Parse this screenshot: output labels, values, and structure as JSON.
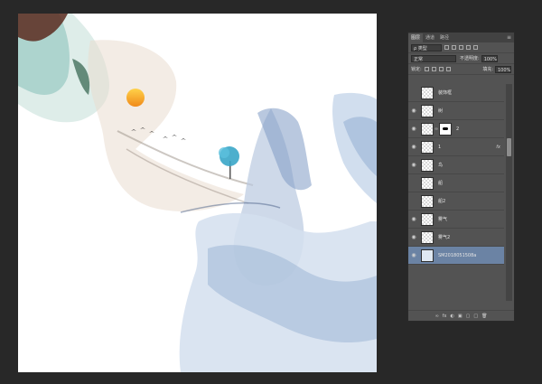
{
  "panel": {
    "tabs": [
      "图层",
      "通道",
      "路径"
    ],
    "menu_glyph": "≡",
    "filter_label": "ρ 类型",
    "blend_mode": "正常",
    "opacity_label": "不透明度:",
    "opacity_value": "100%",
    "lock_label": "锁定:",
    "fill_label": "填充:",
    "fill_value": "100%"
  },
  "layers": [
    {
      "name": "装饰框",
      "visible": false,
      "selected": false
    },
    {
      "name": "树",
      "visible": true,
      "selected": false
    },
    {
      "name": "2",
      "visible": true,
      "selected": false,
      "has_mask": true
    },
    {
      "name": "1",
      "visible": true,
      "selected": false,
      "fx": "fx"
    },
    {
      "name": "鸟",
      "visible": true,
      "selected": false
    },
    {
      "name": "船",
      "visible": false,
      "selected": false
    },
    {
      "name": "船2",
      "visible": false,
      "selected": false
    },
    {
      "name": "雾气",
      "visible": true,
      "selected": false
    },
    {
      "name": "雾气2",
      "visible": true,
      "selected": false
    },
    {
      "name": "SM2018051508a",
      "visible": true,
      "selected": true
    }
  ],
  "footer_icons": [
    "∞",
    "fx",
    "◐",
    "▣",
    "▢",
    "□",
    "🗑"
  ],
  "colors": {
    "accent_selected": "#6b83a4",
    "panel_bg": "#535353",
    "workspace_bg": "#282828"
  }
}
